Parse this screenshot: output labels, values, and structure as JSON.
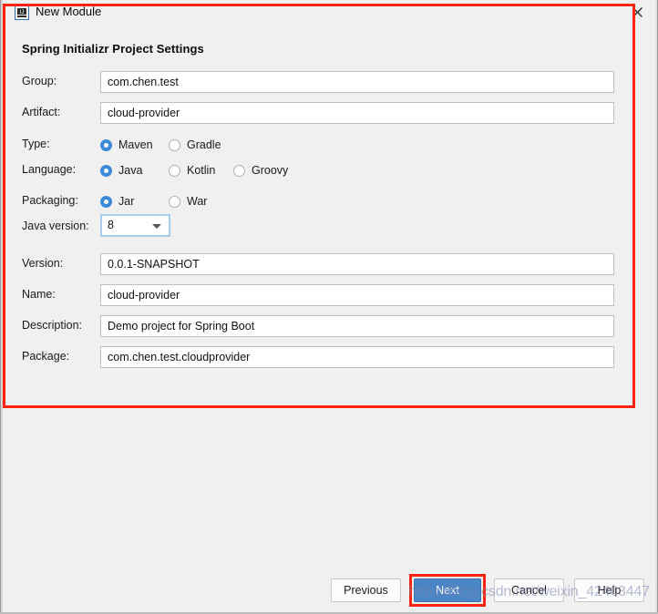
{
  "window": {
    "title": "New Module",
    "icon": "intellij-module-icon",
    "close_icon": "close-icon"
  },
  "section": {
    "title": "Spring Initializr Project Settings"
  },
  "form": {
    "group": {
      "label": "Group:",
      "value": "com.chen.test"
    },
    "artifact": {
      "label": "Artifact:",
      "value": "cloud-provider"
    },
    "type": {
      "label": "Type:",
      "options": [
        {
          "label": "Maven",
          "selected": true
        },
        {
          "label": "Gradle",
          "selected": false
        }
      ]
    },
    "language": {
      "label": "Language:",
      "options": [
        {
          "label": "Java",
          "selected": true
        },
        {
          "label": "Kotlin",
          "selected": false
        },
        {
          "label": "Groovy",
          "selected": false
        }
      ]
    },
    "packaging": {
      "label": "Packaging:",
      "options": [
        {
          "label": "Jar",
          "selected": true
        },
        {
          "label": "War",
          "selected": false
        }
      ]
    },
    "java_version": {
      "label": "Java version:",
      "value": "8"
    },
    "version": {
      "label": "Version:",
      "value": "0.0.1-SNAPSHOT"
    },
    "name": {
      "label": "Name:",
      "value": "cloud-provider"
    },
    "description": {
      "label": "Description:",
      "value": "Demo project for Spring Boot"
    },
    "package": {
      "label": "Package:",
      "value": "com.chen.test.cloudprovider"
    }
  },
  "buttons": {
    "previous": "Previous",
    "next": "Next",
    "cancel": "Cancel",
    "help": "Help"
  },
  "annotation": {
    "color": "#fc2410"
  },
  "watermark": {
    "text": "https://blog.csdn.net/weixin_42463447"
  }
}
